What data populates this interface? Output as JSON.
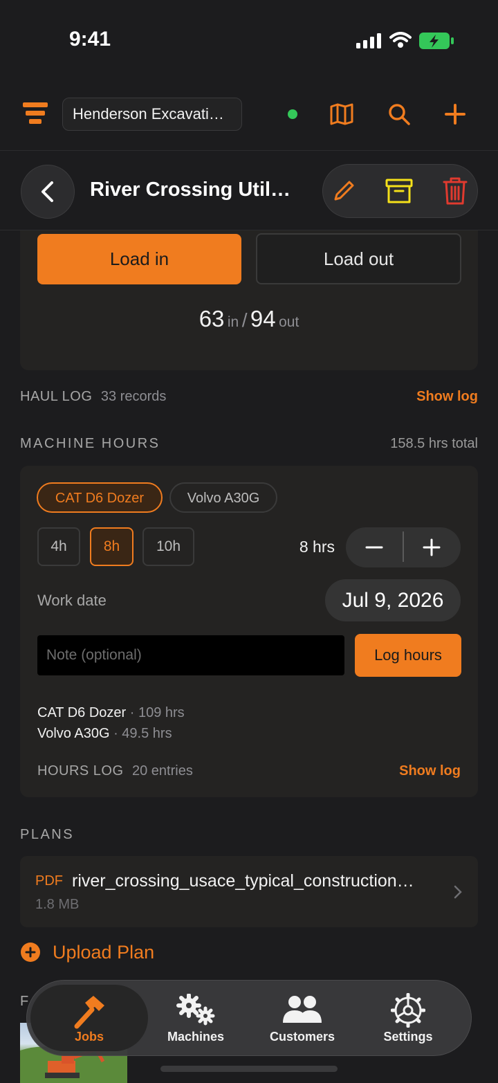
{
  "status_bar": {
    "time": "9:41"
  },
  "header": {
    "org_name": "Henderson Excavati…"
  },
  "title_bar": {
    "title": "River Crossing Util…"
  },
  "load": {
    "in_label": "Load in",
    "out_label": "Load out",
    "in_count": "63",
    "in_unit": "in",
    "separator": "/",
    "out_count": "94",
    "out_unit": "out"
  },
  "haul_log": {
    "label": "HAUL LOG",
    "count": "33 records",
    "link": "Show log"
  },
  "machine_hours": {
    "label": "MACHINE HOURS",
    "total": "158.5 hrs total",
    "machines": [
      "CAT D6 Dozer",
      "Volvo A30G"
    ],
    "presets": [
      "4h",
      "8h",
      "10h"
    ],
    "selected_hours": "8 hrs",
    "work_date_label": "Work date",
    "work_date": "Jul 9, 2026",
    "note_placeholder": "Note (optional)",
    "log_button": "Log hours",
    "summary": [
      {
        "name": "CAT D6 Dozer",
        "hours": "· 109 hrs"
      },
      {
        "name": "Volvo A30G",
        "hours": "· 49.5 hrs"
      }
    ],
    "log_label": "HOURS LOG",
    "log_count": "20 entries",
    "log_link": "Show log"
  },
  "plans": {
    "label": "PLANS",
    "file_type": "PDF",
    "file_name": "river_crossing_usace_typical_construction…",
    "file_size": "1.8 MB",
    "upload_label": "Upload Plan"
  },
  "photos": {
    "label_partial": "F"
  },
  "tabs": [
    {
      "label": "Jobs",
      "icon": "hammer-icon",
      "active": true
    },
    {
      "label": "Machines",
      "icon": "gears-icon",
      "active": false
    },
    {
      "label": "Customers",
      "icon": "people-icon",
      "active": false
    },
    {
      "label": "Settings",
      "icon": "gear-icon",
      "active": false
    }
  ],
  "colors": {
    "accent": "#f07c1f",
    "archive": "#f5e11a",
    "delete": "#e03a2f",
    "online": "#34c759",
    "background": "#1c1c1e"
  }
}
